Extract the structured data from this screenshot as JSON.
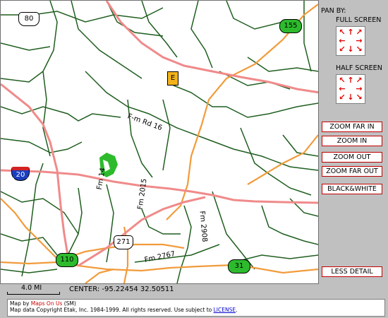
{
  "map": {
    "shields": {
      "us80": "80",
      "i20": "20",
      "us271": "271",
      "sh155": "155",
      "sh110": "110",
      "sh31": "31",
      "marker_e": "E"
    },
    "road_labels": {
      "fm_rd16": "F-m Rd 16",
      "fm14": "Fm 14",
      "fm2015": "Fm 2015",
      "fm2908": "Fm 2908",
      "fm2767": "Fm 2767"
    },
    "colors": {
      "interstate": "#f08a8a",
      "highway": "#f29b3b",
      "county_road": "#1f5e1f",
      "park": "#2dbb2d"
    }
  },
  "panel": {
    "pan_by": "PAN BY:",
    "full_screen": "FULL SCREEN",
    "half_screen": "HALF SCREEN",
    "arrows": {
      "nw": "↖",
      "n": "↑",
      "ne": "↗",
      "w": "←",
      "e": "→",
      "sw": "↙",
      "s": "↓",
      "se": "↘"
    },
    "buttons": {
      "zoom_far_in": "ZOOM FAR IN",
      "zoom_in": "ZOOM IN",
      "zoom_out": "ZOOM OUT",
      "zoom_far_out": "ZOOM FAR OUT",
      "black_white": "BLACK&WHITE",
      "less_detail": "LESS DETAIL"
    }
  },
  "footer": {
    "scale_label": "4.0 MI",
    "center_label": "CENTER: -95.22454 32.50511",
    "credits_line1_prefix": "Map by ",
    "credits_line1_link": "Maps On Us",
    "credits_line1_suffix": " (SM)",
    "credits_line2_prefix": "Map data Copyright Etak, Inc. 1984-1999. All rights reserved. Use subject to ",
    "credits_line2_link": "LICENSE",
    "credits_line2_suffix": "."
  }
}
